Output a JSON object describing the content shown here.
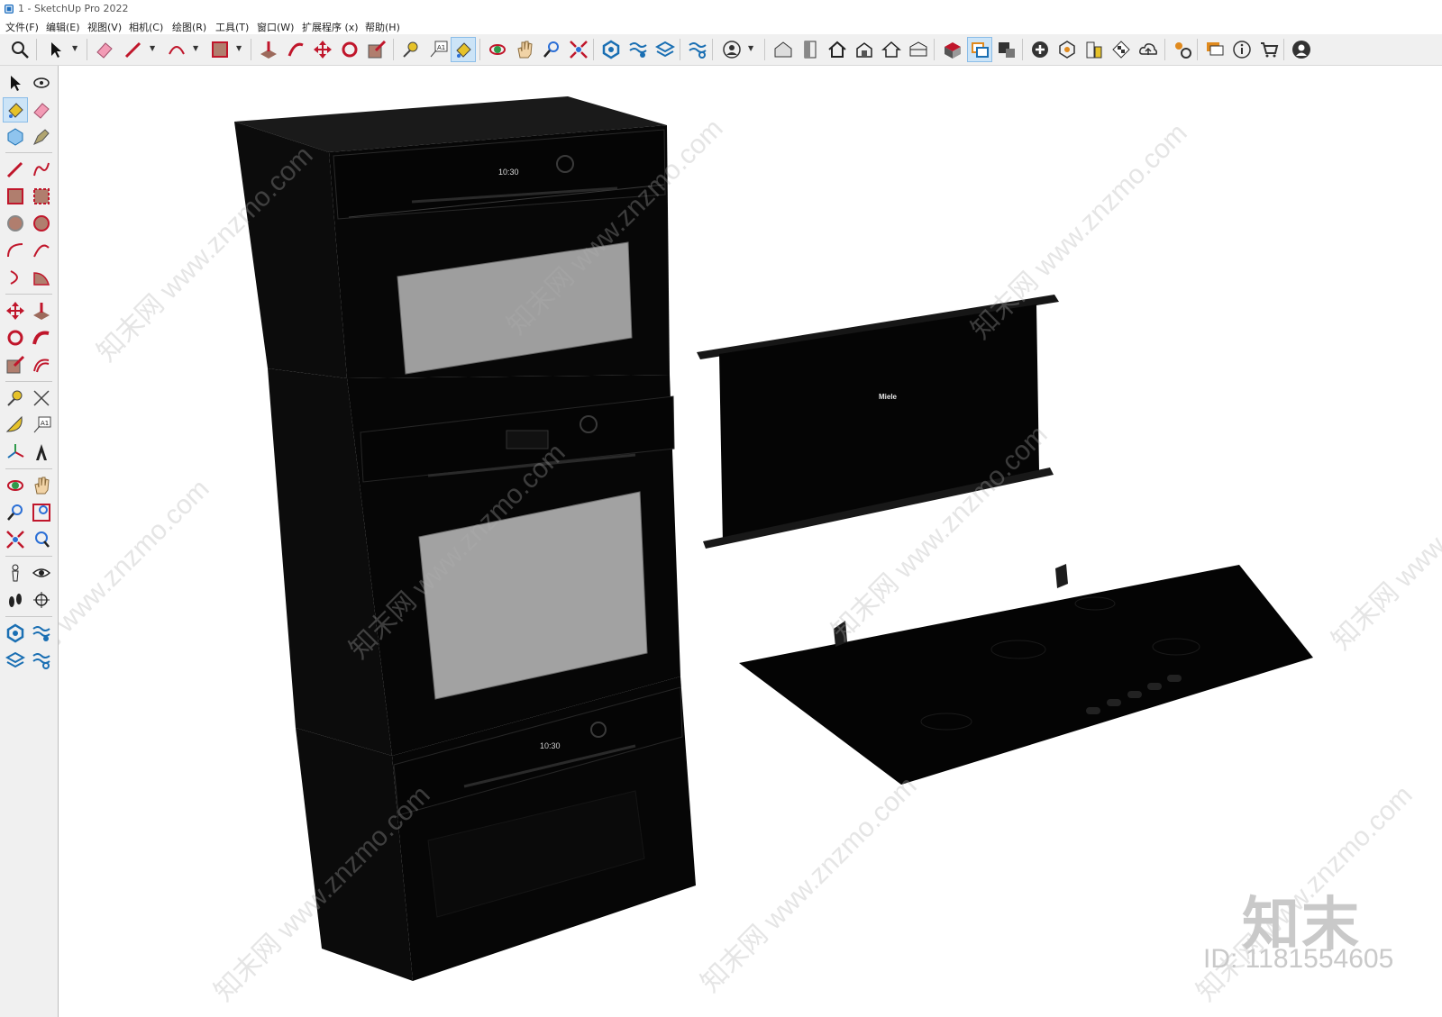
{
  "window": {
    "title": "1 - SketchUp Pro 2022"
  },
  "menu": {
    "items": [
      "文件(F)",
      "编辑(E)",
      "视图(V)",
      "相机(C)",
      "绘图(R)",
      "工具(T)",
      "窗口(W)",
      "扩展程序 (x)",
      "帮助(H)"
    ]
  },
  "toolbar": {
    "icons": [
      "zoom-icon",
      "select-icon",
      "eraser-icon",
      "pencil-icon",
      "arc-icon",
      "rectangle-icon",
      "push-pull-icon",
      "follow-me-icon",
      "move-icon",
      "rotate-icon",
      "scale-icon",
      "tape-measure-icon",
      "text-icon",
      "paint-bucket-icon",
      "orbit-icon",
      "pan-icon",
      "zoom-window-icon",
      "zoom-extents-icon",
      "sandbox-icon",
      "warehouse-icon",
      "profile-icon",
      "house-icon",
      "door-icon",
      "home-icon",
      "component-icon",
      "extension-warehouse-icon",
      "layout-icon",
      "settings-icon",
      "chat-icon",
      "info-icon",
      "cart-icon",
      "account-icon"
    ]
  },
  "lefttoolbar": {
    "icons": [
      "select-icon",
      "orbit-icon",
      "paint-bucket-icon",
      "eraser-icon",
      "component-icon",
      "tag-icon",
      "line-icon",
      "freehand-icon",
      "rectangle-icon",
      "rotated-rectangle-icon",
      "circle-icon",
      "polygon-icon",
      "arc-icon",
      "pie-icon",
      "move-icon",
      "push-pull-icon",
      "rotate-icon",
      "follow-me-icon",
      "scale-icon",
      "offset-icon",
      "tape-measure-icon",
      "dimension-icon",
      "protractor-icon",
      "text-icon",
      "axes-icon",
      "3d-text-icon",
      "orbit-icon",
      "pan-icon",
      "zoom-icon",
      "zoom-window-icon",
      "zoom-extents-icon",
      "previous-view-icon",
      "position-camera-icon",
      "look-around-icon",
      "walk-icon",
      "section-plane-icon",
      "sandbox-icon",
      "sandbox-scratch-icon",
      "sandbox-smoove-icon",
      "sandbox-stamp-icon"
    ]
  },
  "scene": {
    "oven_top_clock": "10:30",
    "oven_bottom_clock": "10:30",
    "hood_brand": "Miele",
    "colors": {
      "appliance": "#0a0a0a",
      "appliance_edge": "#1c1c1c",
      "glass": "#9a9a9a",
      "background": "#ffffff"
    }
  },
  "watermark": {
    "text": "知末网 www.znzmo.com",
    "logo": "知末",
    "id": "ID: 1181554605"
  }
}
